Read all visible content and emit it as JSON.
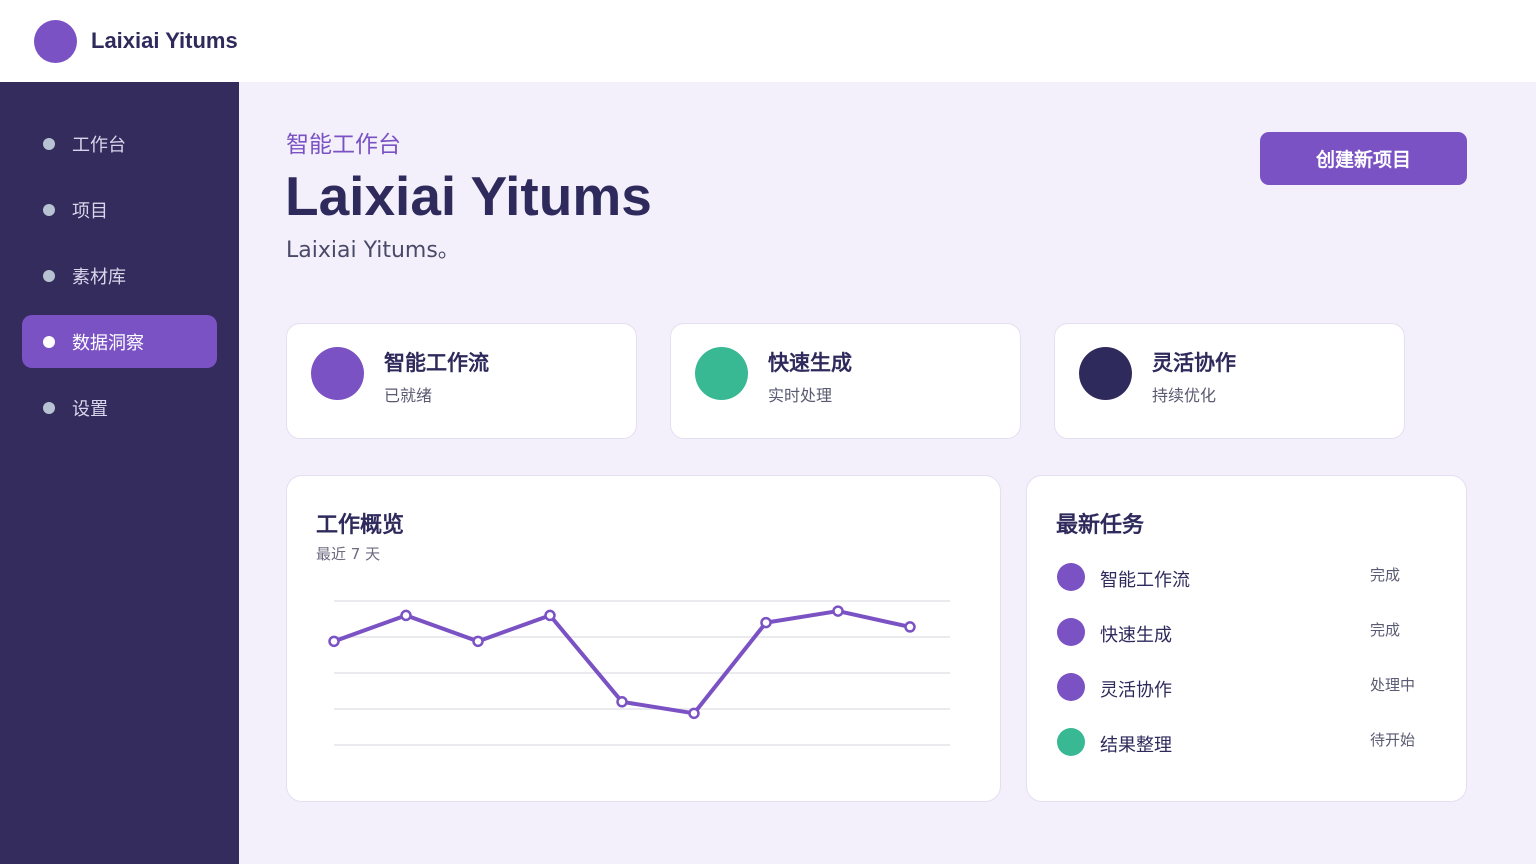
{
  "app": {
    "brand": "Laixiai Yitums"
  },
  "sidebar": {
    "items": [
      {
        "label": "工作台"
      },
      {
        "label": "项目"
      },
      {
        "label": "素材库"
      },
      {
        "label": "数据洞察",
        "active": true
      },
      {
        "label": "设置"
      }
    ]
  },
  "header": {
    "eyebrow": "智能工作台",
    "title": "Laixiai Yitums",
    "subtitle": "Laixiai Yitums。",
    "create_label": "创建新项目"
  },
  "features": [
    {
      "title": "智能工作流",
      "sub": "已就绪",
      "color": "#7a52c4"
    },
    {
      "title": "快速生成",
      "sub": "实时处理",
      "color": "#38b893"
    },
    {
      "title": "灵活协作",
      "sub": "持续优化",
      "color": "#2f2a5c"
    }
  ],
  "overview": {
    "title": "工作概览",
    "subtitle": "最近 7 天"
  },
  "chart_data": {
    "type": "line",
    "x": [
      1,
      2,
      3,
      4,
      5,
      6,
      7,
      8,
      9
    ],
    "series": [
      {
        "values": [
          72,
          90,
          72,
          90,
          30,
          22,
          85,
          93,
          82
        ],
        "color": "#7a52c4"
      }
    ],
    "ylim": [
      0,
      100
    ],
    "grid": true,
    "gridlines": 5
  },
  "tasks": {
    "title": "最新任务",
    "items": [
      {
        "name": "智能工作流",
        "status": "完成",
        "color": "#7a52c4"
      },
      {
        "name": "快速生成",
        "status": "完成",
        "color": "#7a52c4"
      },
      {
        "name": "灵活协作",
        "status": "处理中",
        "color": "#7a52c4"
      },
      {
        "name": "结果整理",
        "status": "待开始",
        "color": "#38b893"
      }
    ]
  },
  "colors": {
    "accent": "#7a52c4",
    "green": "#38b893",
    "navy": "#332c5c"
  }
}
